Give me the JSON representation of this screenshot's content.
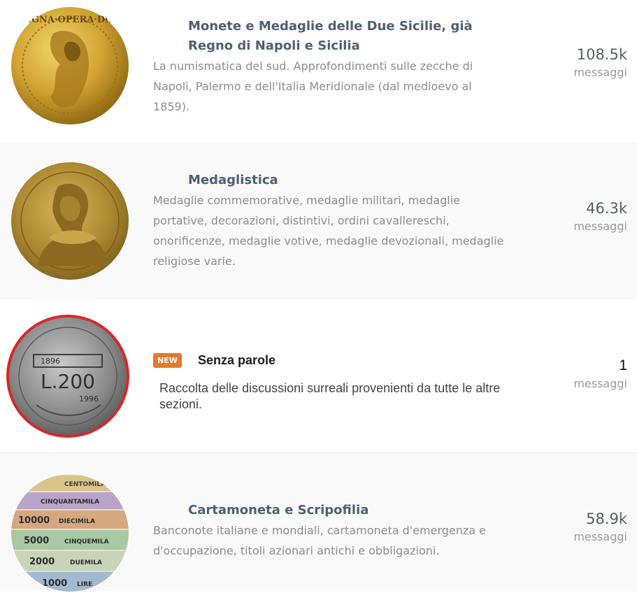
{
  "forums": [
    {
      "title": "Monete e Medaglie delle Due Sicilie, già Regno di Napoli e Sicilia",
      "description": "La numismatica del sud. Approfondimenti sulle zecche di Napoli, Palermo e dell'Italia Meridionale (dal medioevo al 1859).",
      "count": "108.5k",
      "unit": "messaggi",
      "coin_inscription": "REGNA·OPERA·DOM"
    },
    {
      "title": "Medaglistica",
      "description": "Medaglie commemorative, medaglie militari, medaglie portative, decorazioni, distintivi, ordini cavallereschi, onorificenze, medaglie votive, medaglie devozionali, medaglie religiose varie.",
      "count": "46.3k",
      "unit": "messaggi"
    },
    {
      "badge": "NEW",
      "title": "Senza parole",
      "description": "Raccolta delle discussioni surreali provenienti da tutte le altre sezioni.",
      "count": "1",
      "unit": "messaggi",
      "coin_value": "L.200",
      "coin_years_left": "1896",
      "coin_years_right": "1996"
    },
    {
      "title": "Cartamoneta e Scripofilia",
      "description": "Banconote italiane e mondiali, cartamoneta d'emergenza e d'occupazione, titoli azionari antichi e obbligazioni.",
      "count": "58.9k",
      "unit": "messaggi",
      "notes": [
        "CENTOMILA",
        "CINQUANTAMILA",
        "10000",
        "DIECIMILA",
        "5000",
        "CINQUEMILA",
        "2000",
        "DUEMILA",
        "1000",
        "LIRE"
      ]
    }
  ]
}
